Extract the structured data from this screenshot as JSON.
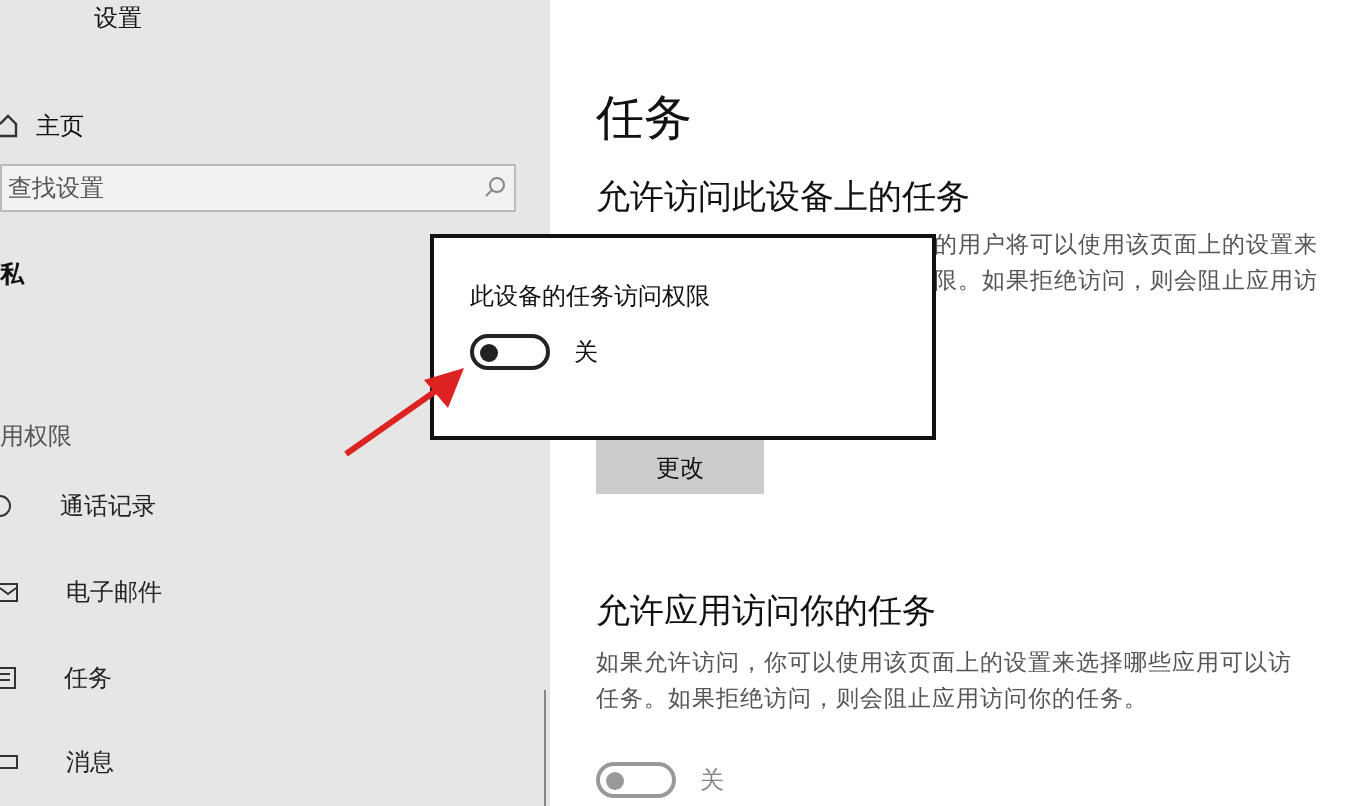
{
  "window": {
    "title": "设置"
  },
  "sidebar": {
    "home": "主页",
    "search": {
      "placeholder": "查找设置"
    },
    "section": "私",
    "group": "用权限",
    "items": [
      {
        "label": "通话记录"
      },
      {
        "label": "电子邮件"
      },
      {
        "label": "任务"
      },
      {
        "label": "消息"
      }
    ]
  },
  "main": {
    "title": "任务",
    "sections": [
      {
        "heading": "允许访问此设备上的任务",
        "lines": [
          "的用户将可以使用该页面上的设置来",
          "限。如果拒绝访问，则会阻止应用访"
        ],
        "button": "更改"
      },
      {
        "heading": "允许应用访问你的任务",
        "lines": [
          "如果允许访问，你可以使用该页面上的设置来选择哪些应用可以访",
          "任务。如果拒绝访问，则会阻止应用访问你的任务。"
        ],
        "toggle": {
          "on": false,
          "label": "关"
        }
      }
    ]
  },
  "popup": {
    "title": "此设备的任务访问权限",
    "toggle": {
      "on": false,
      "label": "关"
    }
  }
}
